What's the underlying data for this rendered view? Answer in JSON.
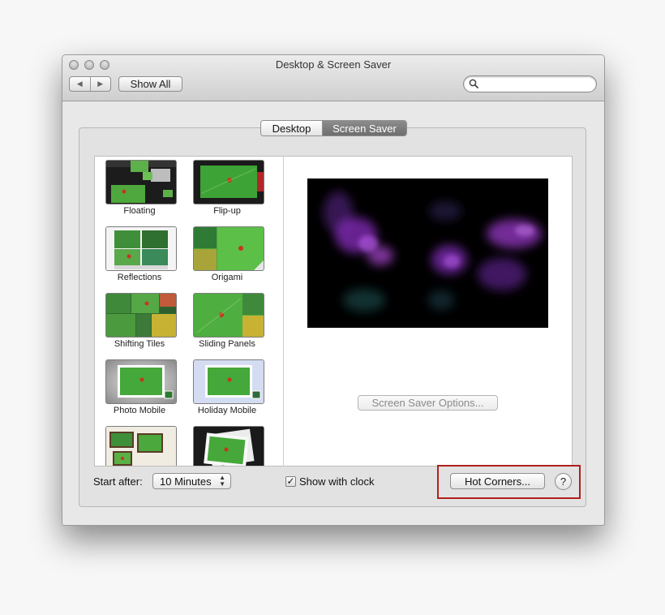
{
  "window": {
    "title": "Desktop & Screen Saver"
  },
  "toolbar": {
    "back_icon": "◀",
    "forward_icon": "▶",
    "show_all_label": "Show All",
    "search_placeholder": ""
  },
  "tabs": [
    {
      "label": "Desktop",
      "selected": false
    },
    {
      "label": "Screen Saver",
      "selected": true
    }
  ],
  "screensavers": [
    {
      "name": "Floating",
      "icon": "floating-thumbnail"
    },
    {
      "name": "Flip-up",
      "icon": "flip-up-thumbnail"
    },
    {
      "name": "Reflections",
      "icon": "reflections-thumbnail"
    },
    {
      "name": "Origami",
      "icon": "origami-thumbnail"
    },
    {
      "name": "Shifting Tiles",
      "icon": "shifting-tiles-thumbnail"
    },
    {
      "name": "Sliding Panels",
      "icon": "sliding-panels-thumbnail"
    },
    {
      "name": "Photo Mobile",
      "icon": "photo-mobile-thumbnail"
    },
    {
      "name": "Holiday Mobile",
      "icon": "holiday-mobile-thumbnail"
    },
    {
      "name": "",
      "icon": "photo-wall-thumbnail"
    },
    {
      "name": "",
      "icon": "vintage-prints-thumbnail"
    }
  ],
  "preview": {
    "options_label": "Screen Saver Options..."
  },
  "footer": {
    "start_after_label": "Start after:",
    "start_after_value": "10 Minutes",
    "show_clock_label": "Show with clock",
    "show_clock_checked": true,
    "check_mark": "✓",
    "hot_corners_label": "Hot Corners...",
    "help_label": "?"
  },
  "colors": {
    "highlight": "#b0201b",
    "selected_tab": "#7a7a7a",
    "preview_purple": "#8a2fc0"
  }
}
